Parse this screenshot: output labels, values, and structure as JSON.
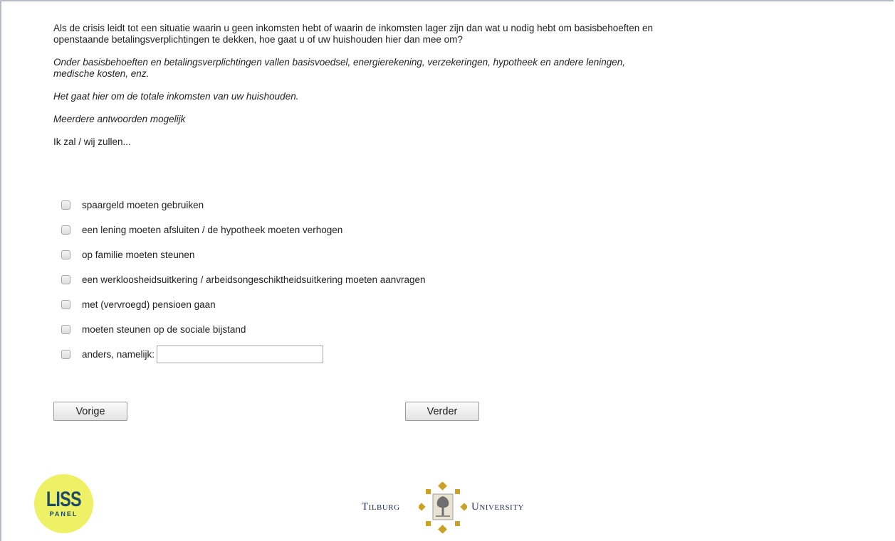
{
  "question": {
    "main": "Als de crisis leidt tot een situatie waarin u geen inkomsten hebt of waarin de inkomsten lager zijn dan wat u nodig hebt om basisbehoeften en",
    "main_line2": "openstaande betalingsverplichtingen te dekken, hoe gaat u of uw huishouden hier dan mee om?",
    "note1": "Onder basisbehoeften en betalingsverplichtingen vallen basisvoedsel, energierekening, verzekeringen, hypotheek en andere leningen,",
    "note1_line2": "medische kosten, enz.",
    "note2": "Het gaat hier om de totale inkomsten van uw huishouden.",
    "note3": "Meerdere antwoorden mogelijk",
    "lead": "Ik zal / wij zullen..."
  },
  "options": [
    {
      "label": "spaargeld moeten gebruiken",
      "checked": false
    },
    {
      "label": "een lening moeten afsluiten / de hypotheek moeten verhogen",
      "checked": false
    },
    {
      "label": "op familie moeten steunen",
      "checked": false
    },
    {
      "label": "een werkloosheidsuitkering / arbeidsongeschiktheidsuitkering moeten aanvragen",
      "checked": false
    },
    {
      "label": "met (vervroegd) pensioen gaan",
      "checked": false
    },
    {
      "label": "moeten steunen op de sociale bijstand",
      "checked": false
    },
    {
      "label": "anders, namelijk:",
      "checked": false
    }
  ],
  "other_input": {
    "value": "",
    "placeholder": ""
  },
  "buttons": {
    "prev_label": "Vorige",
    "next_label": "Verder"
  },
  "logos": {
    "liss_main": "LISS",
    "liss_sub": "PANEL",
    "tilburg_left": "Tilburg",
    "tilburg_right": "University"
  },
  "colors": {
    "liss_bg": "#eef166",
    "liss_text": "#1d4a66",
    "tilburg_gold": "#c9a227",
    "tilburg_text": "#1f2f5a"
  }
}
